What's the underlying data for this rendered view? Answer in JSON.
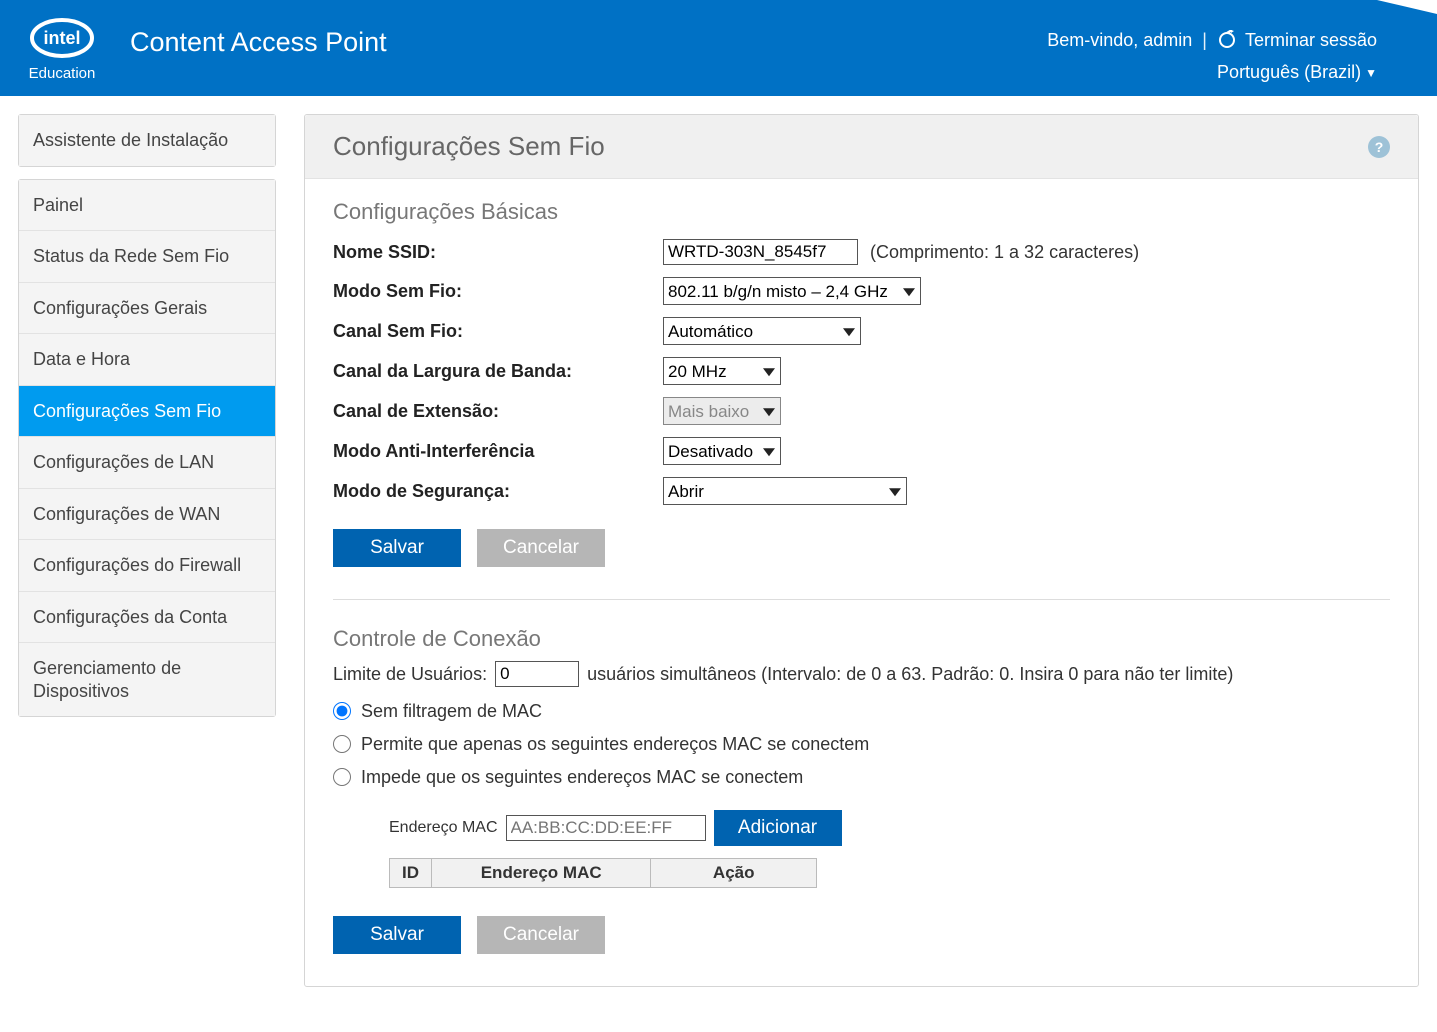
{
  "header": {
    "app_title": "Content Access Point",
    "welcome": "Bem-vindo, admin",
    "logout": "Terminar sessão",
    "language": "Português (Brazil)"
  },
  "sidebar": {
    "install_wizard": "Assistente de Instalação",
    "items": [
      "Painel",
      "Status da Rede Sem Fio",
      "Configurações Gerais",
      "Data e Hora",
      "Configurações Sem Fio",
      "Configurações de LAN",
      "Configurações de WAN",
      "Configurações do Firewall",
      "Configurações da Conta",
      "Gerenciamento de Dispositivos"
    ],
    "active_index": 4
  },
  "page_title": "Configurações Sem Fio",
  "help_icon_text": "?",
  "basic": {
    "section_title": "Configurações Básicas",
    "ssid_label": "Nome SSID:",
    "ssid_value": "WRTD-303N_8545f7",
    "ssid_hint": "(Comprimento: 1 a 32 caracteres)",
    "mode_label": "Modo Sem Fio:",
    "mode_value": "802.11 b/g/n misto – 2,4 GHz",
    "channel_label": "Canal Sem Fio:",
    "channel_value": "Automático",
    "bandwidth_label": "Canal da Largura de Banda:",
    "bandwidth_value": "20 MHz",
    "ext_label": "Canal de Extensão:",
    "ext_value": "Mais baixo",
    "anti_label": "Modo Anti-Interferência",
    "anti_value": "Desativado",
    "sec_label": "Modo de Segurança:",
    "sec_value": "Abrir",
    "save": "Salvar",
    "cancel": "Cancelar"
  },
  "conn": {
    "section_title": "Controle de Conexão",
    "user_limit_label": "Limite de Usuários:",
    "user_limit_value": "0",
    "user_limit_hint": "usuários simultâneos (Intervalo: de 0 a 63. Padrão: 0. Insira 0 para não ter limite)",
    "filter_options": [
      "Sem filtragem de MAC",
      "Permite que apenas os seguintes endereços MAC se conectem",
      "Impede que os seguintes endereços MAC se conectem"
    ],
    "filter_selected": 0,
    "mac_label": "Endereço MAC",
    "mac_placeholder": "AA:BB:CC:DD:EE:FF",
    "add": "Adicionar",
    "table": {
      "id": "ID",
      "addr": "Endereço MAC",
      "action": "Ação"
    },
    "save": "Salvar",
    "cancel": "Cancelar"
  }
}
